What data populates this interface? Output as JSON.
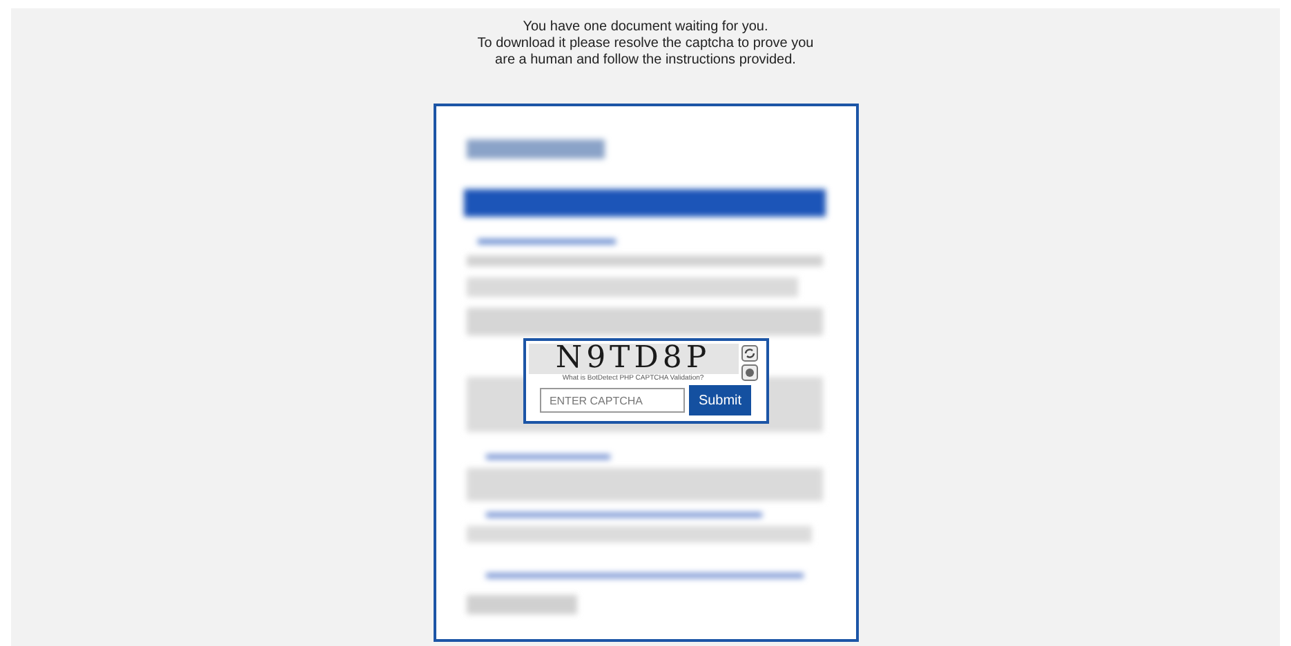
{
  "message": [
    "You have one document waiting for you.",
    "To download it please resolve the captcha to prove you",
    "are a human and follow the instructions provided."
  ],
  "captcha": {
    "code": "N9TD8P",
    "caption": "What is BotDetect PHP CAPTCHA Validation?",
    "input": {
      "placeholder": "ENTER CAPTCHA"
    },
    "submit": "Submit"
  }
}
